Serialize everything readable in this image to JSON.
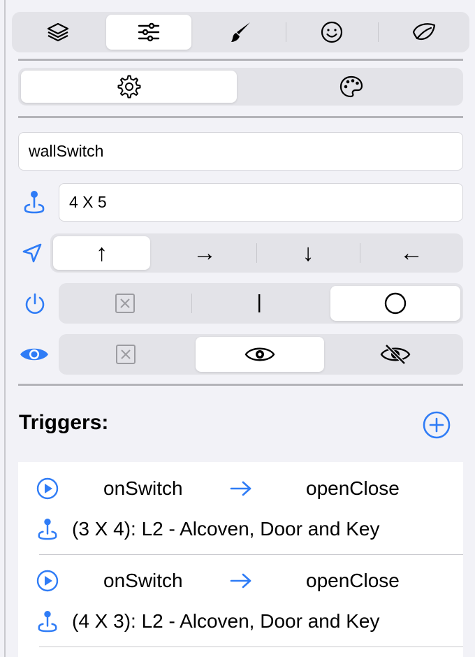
{
  "colors": {
    "accent": "#2f7cf6",
    "background": "#f2f2f7",
    "segment_bg": "#e3e3e8"
  },
  "top_tabs": [
    {
      "icon": "layers-icon",
      "selected": false
    },
    {
      "icon": "sliders-icon",
      "selected": true
    },
    {
      "icon": "paintbrush-icon",
      "selected": false
    },
    {
      "icon": "smiley-icon",
      "selected": false
    },
    {
      "icon": "leaf-icon",
      "selected": false
    }
  ],
  "sub_tabs": [
    {
      "icon": "gear-icon",
      "selected": true
    },
    {
      "icon": "palette-icon",
      "selected": false
    }
  ],
  "name_field": {
    "value": "wallSwitch"
  },
  "position_field": {
    "icon": "joystick-icon",
    "value": "4 X 5"
  },
  "direction": {
    "icon": "location-arrow-icon",
    "options": [
      "↑",
      "→",
      "↓",
      "←"
    ],
    "selected": "↑"
  },
  "power": {
    "icon": "power-icon",
    "options": [
      "none",
      "on",
      "off"
    ],
    "selected": "off"
  },
  "visibility": {
    "icon": "eye-icon",
    "options": [
      "none",
      "visible",
      "hidden"
    ],
    "selected": "visible"
  },
  "triggers": {
    "heading": "Triggers:",
    "add_icon": "plus-circle-icon",
    "items": [
      {
        "event": "onSwitch",
        "action": "openClose",
        "target": "(3 X 4): L2 - Alcoven, Door and Key"
      },
      {
        "event": "onSwitch",
        "action": "openClose",
        "target": "(4 X 3): L2 - Alcoven, Door and Key"
      }
    ]
  }
}
